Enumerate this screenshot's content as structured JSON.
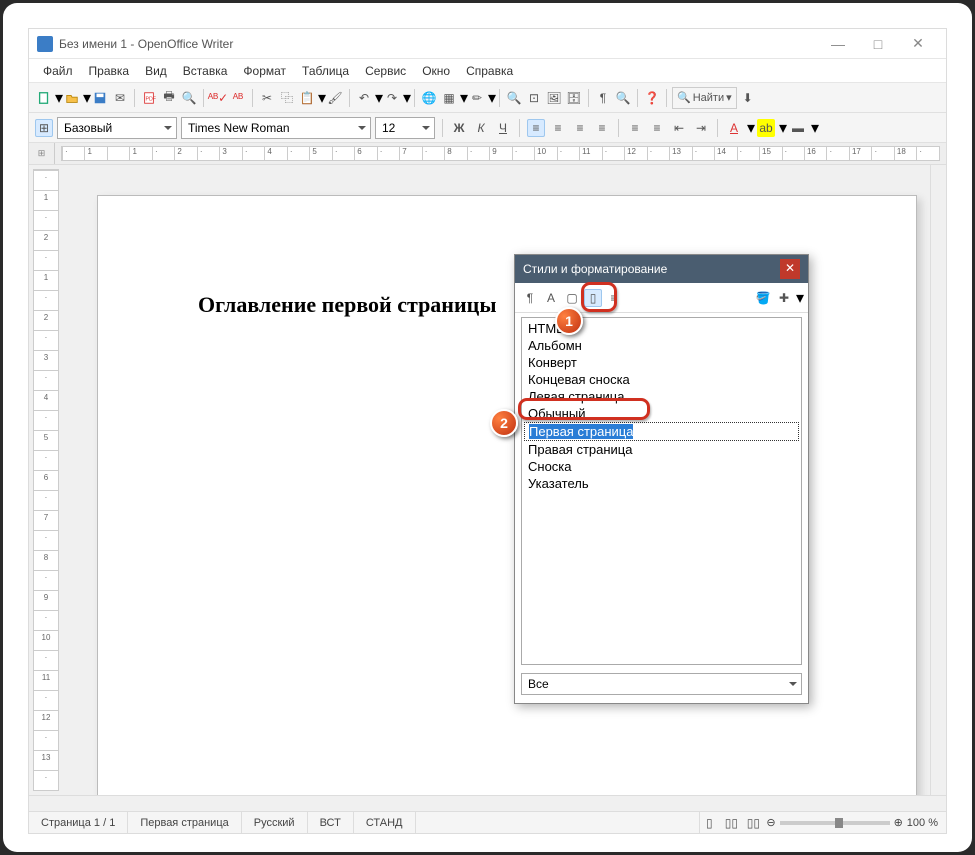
{
  "window": {
    "title": "Без имени 1 - OpenOffice Writer",
    "minimize": "—",
    "maximize": "□",
    "close": "✕"
  },
  "menu": [
    "Файл",
    "Правка",
    "Вид",
    "Вставка",
    "Формат",
    "Таблица",
    "Сервис",
    "Окно",
    "Справка"
  ],
  "formatting": {
    "paragraph_style": "Базовый",
    "font_name": "Times New Roman",
    "font_size": "12",
    "bold": "Ж",
    "italic": "К",
    "underline": "Ч"
  },
  "find": {
    "label": "Найти"
  },
  "ruler_h": [
    "·",
    "1",
    "",
    "1",
    "·",
    "2",
    "·",
    "3",
    "·",
    "4",
    "·",
    "5",
    "·",
    "6",
    "·",
    "7",
    "·",
    "8",
    "·",
    "9",
    "·",
    "10",
    "·",
    "11",
    "·",
    "12",
    "·",
    "13",
    "·",
    "14",
    "·",
    "15",
    "·",
    "16",
    "·",
    "17",
    "·",
    "18",
    "·"
  ],
  "ruler_v": [
    "·",
    "1",
    "·",
    "2",
    "·",
    "1",
    "·",
    "2",
    "·",
    "3",
    "·",
    "4",
    "·",
    "5",
    "·",
    "6",
    "·",
    "7",
    "·",
    "8",
    "·",
    "9",
    "·",
    "10",
    "·",
    "11",
    "·",
    "12",
    "·",
    "13",
    "·"
  ],
  "document": {
    "heading": "Оглавление первой страницы"
  },
  "status": {
    "page": "Страница 1 / 1",
    "page_style": "Первая страница",
    "language": "Русский",
    "insert_mode": "ВСТ",
    "sel_mode": "СТАНД",
    "extra": "",
    "zoom": "100 %"
  },
  "styles_dialog": {
    "title": "Стили и форматирование",
    "close": "✕",
    "items": [
      "HTML",
      "Альбомн",
      "Конверт",
      "Концевая сноска",
      "Левая страница",
      "Обычный",
      "Первая страница",
      "Правая страница",
      "Сноска",
      "Указатель"
    ],
    "selected_index": 6,
    "filter": "Все"
  },
  "callouts": {
    "one": "1",
    "two": "2"
  }
}
